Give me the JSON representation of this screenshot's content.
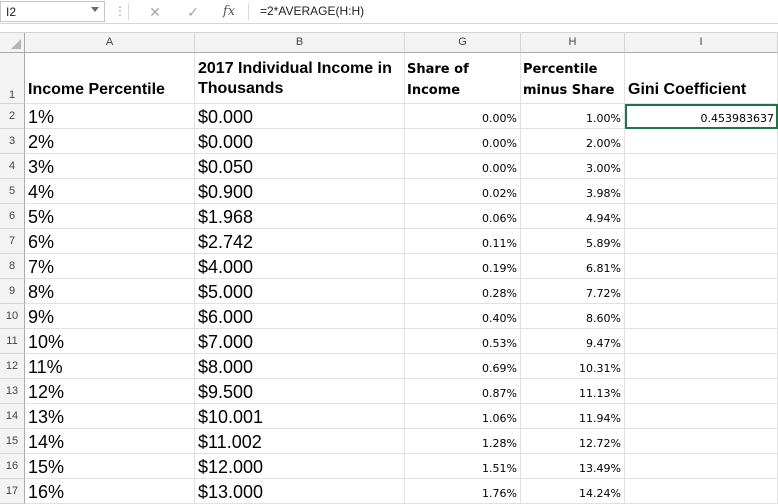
{
  "formula_bar": {
    "name_box": "I2",
    "dots": "⋮",
    "cancel_icon": "✕",
    "enter_icon": "✓",
    "fx_label": "fx",
    "formula": "=2*AVERAGE(H:H)"
  },
  "columns": [
    "A",
    "B",
    "G",
    "H",
    "I"
  ],
  "header_row": {
    "row_number": "1",
    "a": "Income Percentile",
    "b": "2017 Individual Income in Thousands",
    "g": "Share of Income",
    "h": "Percentile minus Share",
    "i": "Gini Coefficient"
  },
  "gini_value": "0.453983637",
  "rows": [
    {
      "n": "2",
      "a": "1%",
      "b": "$0.000",
      "g": "0.00%",
      "h": "1.00%"
    },
    {
      "n": "3",
      "a": "2%",
      "b": "$0.000",
      "g": "0.00%",
      "h": "2.00%"
    },
    {
      "n": "4",
      "a": "3%",
      "b": "$0.050",
      "g": "0.00%",
      "h": "3.00%"
    },
    {
      "n": "5",
      "a": "4%",
      "b": "$0.900",
      "g": "0.02%",
      "h": "3.98%"
    },
    {
      "n": "6",
      "a": "5%",
      "b": "$1.968",
      "g": "0.06%",
      "h": "4.94%"
    },
    {
      "n": "7",
      "a": "6%",
      "b": "$2.742",
      "g": "0.11%",
      "h": "5.89%"
    },
    {
      "n": "8",
      "a": "7%",
      "b": "$4.000",
      "g": "0.19%",
      "h": "6.81%"
    },
    {
      "n": "9",
      "a": "8%",
      "b": "$5.000",
      "g": "0.28%",
      "h": "7.72%"
    },
    {
      "n": "10",
      "a": "9%",
      "b": "$6.000",
      "g": "0.40%",
      "h": "8.60%"
    },
    {
      "n": "11",
      "a": "10%",
      "b": "$7.000",
      "g": "0.53%",
      "h": "9.47%"
    },
    {
      "n": "12",
      "a": "11%",
      "b": "$8.000",
      "g": "0.69%",
      "h": "10.31%"
    },
    {
      "n": "13",
      "a": "12%",
      "b": "$9.500",
      "g": "0.87%",
      "h": "11.13%"
    },
    {
      "n": "14",
      "a": "13%",
      "b": "$10.001",
      "g": "1.06%",
      "h": "11.94%"
    },
    {
      "n": "15",
      "a": "14%",
      "b": "$11.002",
      "g": "1.28%",
      "h": "12.72%"
    },
    {
      "n": "16",
      "a": "15%",
      "b": "$12.000",
      "g": "1.51%",
      "h": "13.49%"
    },
    {
      "n": "17",
      "a": "16%",
      "b": "$13.000",
      "g": "1.76%",
      "h": "14.24%"
    }
  ],
  "colors": {
    "selection": "#217346",
    "header_bg": "#f3f3f3",
    "gridline": "#e1e1e1"
  }
}
